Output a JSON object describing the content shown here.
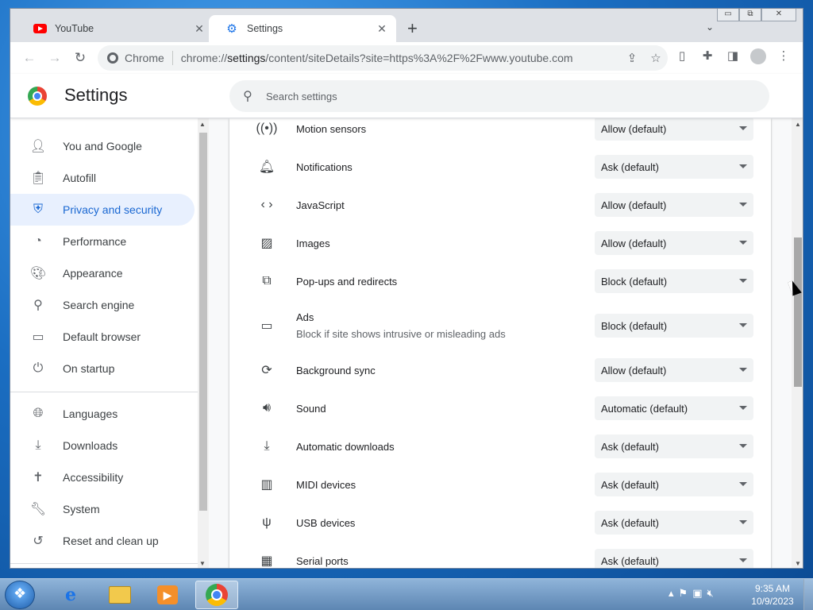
{
  "tabs": [
    {
      "label": "YouTube"
    },
    {
      "label": "Settings"
    }
  ],
  "window_controls": {
    "minimize": "▭",
    "restore": "⧉",
    "close": "✕"
  },
  "toolbar": {
    "chrome_chip": "Chrome",
    "url_prefix": "chrome://",
    "url_host": "settings",
    "url_rest": "/content/siteDetails?site=https%3A%2F%2Fwww.youtube.com"
  },
  "settings_header": {
    "title": "Settings",
    "search_placeholder": "Search settings"
  },
  "sidebar": {
    "items": [
      {
        "label": "You and Google",
        "icon": "person-icon"
      },
      {
        "label": "Autofill",
        "icon": "clipboard-icon"
      },
      {
        "label": "Privacy and security",
        "icon": "shield-icon"
      },
      {
        "label": "Performance",
        "icon": "speedometer-icon"
      },
      {
        "label": "Appearance",
        "icon": "palette-icon"
      },
      {
        "label": "Search engine",
        "icon": "search-icon"
      },
      {
        "label": "Default browser",
        "icon": "browser-icon"
      },
      {
        "label": "On startup",
        "icon": "power-icon"
      },
      {
        "label": "Languages",
        "icon": "globe-icon"
      },
      {
        "label": "Downloads",
        "icon": "download-icon"
      },
      {
        "label": "Accessibility",
        "icon": "accessibility-icon"
      },
      {
        "label": "System",
        "icon": "wrench-icon"
      },
      {
        "label": "Reset and clean up",
        "icon": "reset-icon"
      }
    ],
    "selected": "Privacy and security"
  },
  "permissions": [
    {
      "label": "Motion sensors",
      "value": "Allow (default)",
      "icon": "sensors-icon"
    },
    {
      "label": "Notifications",
      "value": "Ask (default)",
      "icon": "bell-icon"
    },
    {
      "label": "JavaScript",
      "value": "Allow (default)",
      "icon": "code-icon"
    },
    {
      "label": "Images",
      "value": "Allow (default)",
      "icon": "image-icon"
    },
    {
      "label": "Pop-ups and redirects",
      "value": "Block (default)",
      "icon": "popup-icon"
    },
    {
      "label": "Ads",
      "sublabel": "Block if site shows intrusive or misleading ads",
      "value": "Block (default)",
      "icon": "ads-icon"
    },
    {
      "label": "Background sync",
      "value": "Allow (default)",
      "icon": "sync-icon"
    },
    {
      "label": "Sound",
      "value": "Automatic (default)",
      "icon": "speaker-icon"
    },
    {
      "label": "Automatic downloads",
      "value": "Ask (default)",
      "icon": "download-icon"
    },
    {
      "label": "MIDI devices",
      "value": "Ask (default)",
      "icon": "piano-icon"
    },
    {
      "label": "USB devices",
      "value": "Ask (default)",
      "icon": "usb-icon"
    },
    {
      "label": "Serial ports",
      "value": "Ask (default)",
      "icon": "serial-icon"
    }
  ],
  "taskbar": {
    "time": "9:35 AM",
    "date": "10/9/2023"
  },
  "colors": {
    "accent": "#1a73e8",
    "selected_bg": "#e8f0fe",
    "selected_text": "#1967d2"
  }
}
